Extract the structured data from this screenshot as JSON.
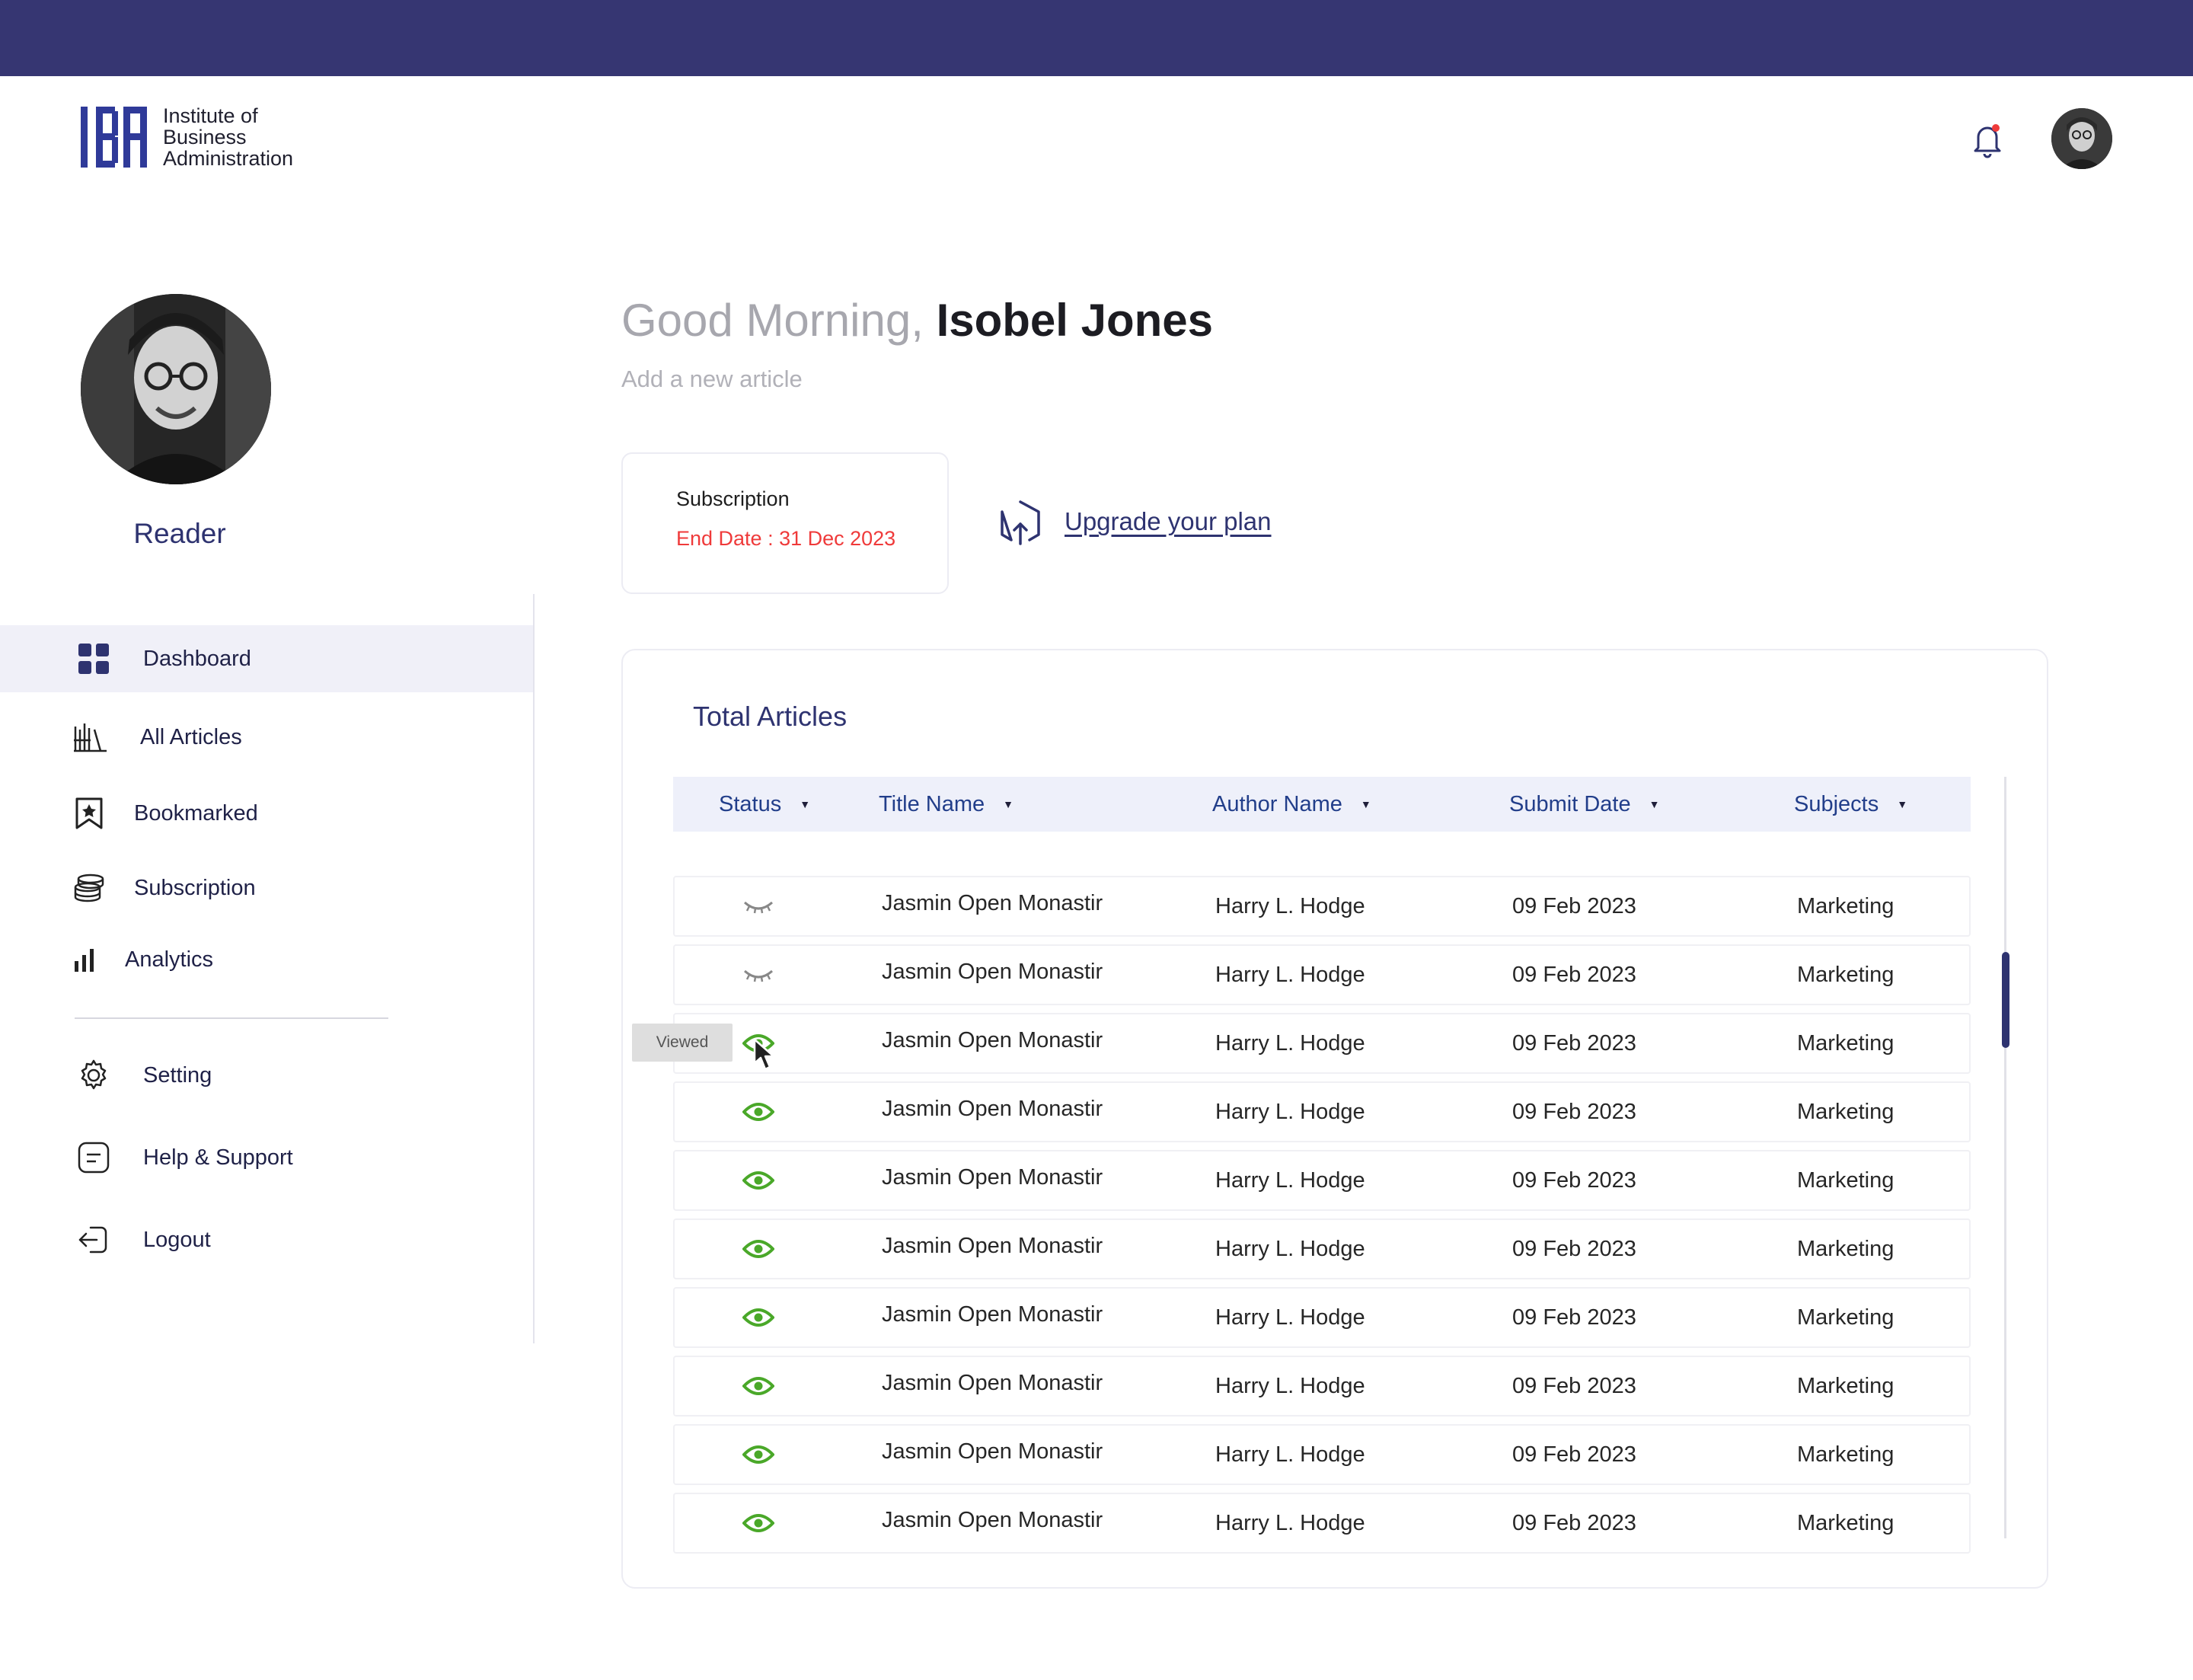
{
  "brand": {
    "logo_letters": "IBA",
    "name_line1": "Institute of",
    "name_line2": "Business",
    "name_line3": "Administration"
  },
  "colors": {
    "primary": "#363672",
    "accent_text": "#2e3370",
    "status_viewed": "#4aa829",
    "status_unviewed": "#888888",
    "end_date": "#ef3a3a"
  },
  "profile": {
    "role": "Reader"
  },
  "sidebar": {
    "items": [
      {
        "label": "Dashboard",
        "icon": "dashboard-grid-icon",
        "active": true
      },
      {
        "label": "All Articles",
        "icon": "books-icon"
      },
      {
        "label": "Bookmarked",
        "icon": "bookmark-star-icon"
      },
      {
        "label": "Subscription",
        "icon": "coins-stack-icon"
      },
      {
        "label": "Analytics",
        "icon": "bar-chart-icon"
      }
    ],
    "secondary": [
      {
        "label": "Setting",
        "icon": "gear-icon"
      },
      {
        "label": "Help & Support",
        "icon": "message-square-icon"
      },
      {
        "label": "Logout",
        "icon": "logout-icon"
      }
    ]
  },
  "header": {
    "greeting": "Good Morning,",
    "user_name": "Isobel Jones",
    "subtitle": "Add a new article"
  },
  "subscription": {
    "title": "Subscription",
    "end_date": "End Date : 31 Dec 2023",
    "upgrade_label": "Upgrade your plan"
  },
  "articles": {
    "title": "Total Articles",
    "columns": [
      "Status",
      "Title Name",
      "Author Name",
      "Submit Date",
      "Subjects"
    ],
    "tooltip": "Viewed",
    "rows": [
      {
        "status": "unviewed",
        "title": "Jasmin Open Monastir",
        "author": "Harry L. Hodge",
        "date": "09 Feb 2023",
        "subject": "Marketing"
      },
      {
        "status": "unviewed",
        "title": "Jasmin Open Monastir",
        "author": "Harry L. Hodge",
        "date": "09 Feb 2023",
        "subject": "Marketing"
      },
      {
        "status": "viewed",
        "title": "Jasmin Open Monastir",
        "author": "Harry L. Hodge",
        "date": "09 Feb 2023",
        "subject": "Marketing"
      },
      {
        "status": "viewed",
        "title": "Jasmin Open Monastir",
        "author": "Harry L. Hodge",
        "date": "09 Feb 2023",
        "subject": "Marketing"
      },
      {
        "status": "viewed",
        "title": "Jasmin Open Monastir",
        "author": "Harry L. Hodge",
        "date": "09 Feb 2023",
        "subject": "Marketing"
      },
      {
        "status": "viewed",
        "title": "Jasmin Open Monastir",
        "author": "Harry L. Hodge",
        "date": "09 Feb 2023",
        "subject": "Marketing"
      },
      {
        "status": "viewed",
        "title": "Jasmin Open Monastir",
        "author": "Harry L. Hodge",
        "date": "09 Feb 2023",
        "subject": "Marketing"
      },
      {
        "status": "viewed",
        "title": "Jasmin Open Monastir",
        "author": "Harry L. Hodge",
        "date": "09 Feb 2023",
        "subject": "Marketing"
      },
      {
        "status": "viewed",
        "title": "Jasmin Open Monastir",
        "author": "Harry L. Hodge",
        "date": "09 Feb 2023",
        "subject": "Marketing"
      },
      {
        "status": "viewed",
        "title": "Jasmin Open Monastir",
        "author": "Harry L. Hodge",
        "date": "09 Feb 2023",
        "subject": "Marketing"
      }
    ]
  }
}
